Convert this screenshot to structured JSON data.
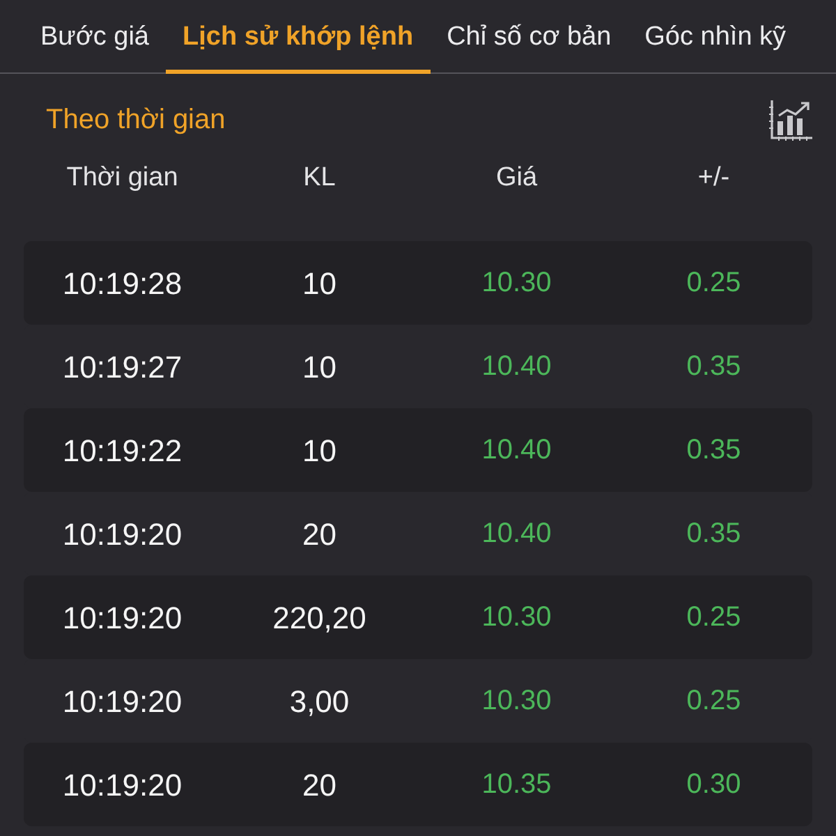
{
  "tabs": [
    {
      "label": "Bước giá",
      "selected": false
    },
    {
      "label": "Lịch sử khớp lệnh",
      "selected": true
    },
    {
      "label": "Chỉ số cơ bản",
      "selected": false
    },
    {
      "label": "Góc nhìn kỹ",
      "selected": false
    }
  ],
  "section": {
    "title": "Theo thời gian"
  },
  "table": {
    "columns": [
      "Thời gian",
      "KL",
      "Giá",
      "+/-"
    ],
    "rows": [
      {
        "time": "10:19:28",
        "volume": "10",
        "price": "10.30",
        "change": "0.25",
        "rising": true
      },
      {
        "time": "10:19:27",
        "volume": "10",
        "price": "10.40",
        "change": "0.35",
        "rising": true
      },
      {
        "time": "10:19:22",
        "volume": "10",
        "price": "10.40",
        "change": "0.35",
        "rising": true
      },
      {
        "time": "10:19:20",
        "volume": "20",
        "price": "10.40",
        "change": "0.35",
        "rising": true
      },
      {
        "time": "10:19:20",
        "volume": "220,20",
        "price": "10.30",
        "change": "0.25",
        "rising": true
      },
      {
        "time": "10:19:20",
        "volume": "3,00",
        "price": "10.30",
        "change": "0.25",
        "rising": true
      },
      {
        "time": "10:19:20",
        "volume": "20",
        "price": "10.35",
        "change": "0.30",
        "rising": true
      }
    ]
  }
}
